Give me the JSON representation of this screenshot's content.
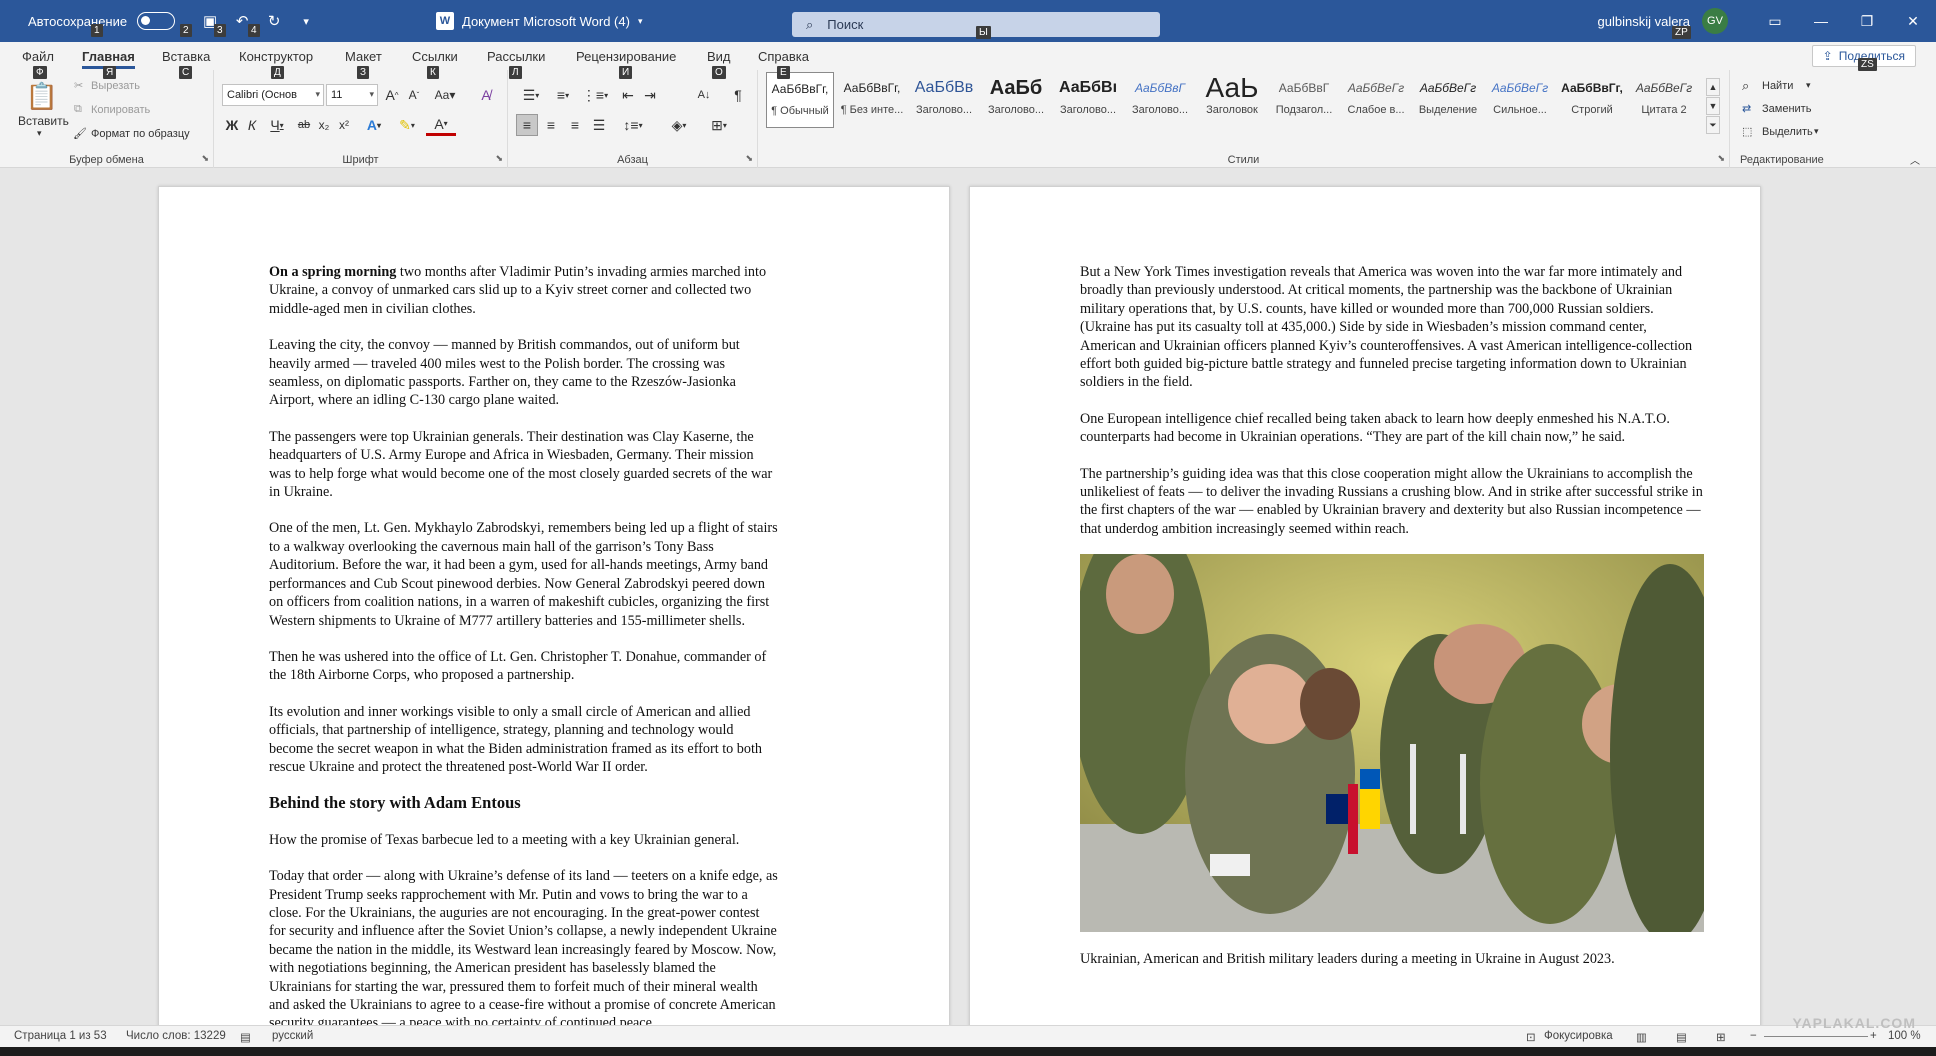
{
  "titlebar": {
    "autosave_label": "Автосохранение",
    "document_title": "Документ Microsoft Word (4)",
    "app_badge": "W",
    "search_placeholder": "Поиск",
    "username": "gulbinskij valera",
    "avatar_initials": "GV",
    "keytips": [
      "1",
      "2",
      "3",
      "4",
      "Ы",
      "ZP"
    ]
  },
  "tabs": [
    {
      "label": "Файл",
      "keytip": "Ф"
    },
    {
      "label": "Главная",
      "keytip": "Я",
      "active": true
    },
    {
      "label": "Вставка",
      "keytip": "С"
    },
    {
      "label": "Конструктор",
      "keytip": "Д"
    },
    {
      "label": "Макет",
      "keytip": "З"
    },
    {
      "label": "Ссылки",
      "keytip": "К"
    },
    {
      "label": "Рассылки",
      "keytip": "Л"
    },
    {
      "label": "Рецензирование",
      "keytip": "И"
    },
    {
      "label": "Вид",
      "keytip": "О"
    },
    {
      "label": "Справка",
      "keytip": "Е"
    }
  ],
  "share": {
    "label": "Поделиться",
    "keytip": "ZS"
  },
  "ribbon": {
    "clipboard": {
      "label": "Буфер обмена",
      "paste": "Вставить",
      "cut": "Вырезать",
      "copy": "Копировать",
      "format_painter": "Формат по образцу"
    },
    "font": {
      "label": "Шрифт",
      "font_name": "Calibri (Основ",
      "font_size": "11"
    },
    "paragraph": {
      "label": "Абзац"
    },
    "styles": {
      "label": "Стили",
      "items": [
        {
          "preview": "АаБбВвГг,",
          "name": "¶ Обычный"
        },
        {
          "preview": "АаБбВвГг,",
          "name": "¶ Без инте..."
        },
        {
          "preview": "АаБбВв",
          "name": "Заголово..."
        },
        {
          "preview": "АаБб",
          "name": "Заголово..."
        },
        {
          "preview": "АаБбВı",
          "name": "Заголово..."
        },
        {
          "preview": "АаБбВвГ",
          "name": "Заголово..."
        },
        {
          "preview": "АаЬ",
          "name": "Заголовок"
        },
        {
          "preview": "АаБбВвГ",
          "name": "Подзагол..."
        },
        {
          "preview": "АаБбВеГг",
          "name": "Слабое в..."
        },
        {
          "preview": "АаБбВеГг",
          "name": "Выделение"
        },
        {
          "preview": "АаБбВеГг",
          "name": "Сильное..."
        },
        {
          "preview": "АаБбВвГг,",
          "name": "Строгий"
        },
        {
          "preview": "АаБбВеГг",
          "name": "Цитата 2"
        }
      ]
    },
    "editing": {
      "label": "Редактирование",
      "find": "Найти",
      "replace": "Заменить",
      "select": "Выделить"
    }
  },
  "page_left": {
    "p1_lead": "On a spring morning",
    "p1_rest": " two months after Vladimir Putin’s invading armies marched into Ukraine, a convoy of unmarked cars slid up to a Kyiv street corner and collected two middle-aged men in civilian clothes.",
    "p2": "Leaving the city, the convoy — manned by British commandos, out of uniform but heavily armed — traveled 400 miles west to the Polish border. The crossing was seamless, on diplomatic passports. Farther on, they came to the Rzeszów-Jasionka Airport, where an idling C-130 cargo plane waited.",
    "p3": "The passengers were top Ukrainian generals. Their destination was Clay Kaserne, the headquarters of U.S. Army Europe and Africa in Wiesbaden, Germany. Their mission was to help forge what would become one of the most closely guarded secrets of the war in Ukraine.",
    "p4": "One of the men, Lt. Gen. Mykhaylo Zabrodskyi, remembers being led up a flight of stairs to a walkway overlooking the cavernous main hall of the garrison’s Tony Bass Auditorium. Before the war, it had been a gym, used for all-hands meetings, Army band performances and Cub Scout pinewood derbies. Now General Zabrodskyi peered down on officers from coalition nations, in a warren of makeshift cubicles, organizing the first Western shipments to Ukraine of M777 artillery batteries and 155-millimeter shells.",
    "p5": "Then he was ushered into the office of Lt. Gen. Christopher T. Donahue, commander of the 18th Airborne Corps, who proposed a partnership.",
    "p6": "Its evolution and inner workings visible to only a small circle of American and allied officials, that partnership of intelligence, strategy, planning and technology would become the secret weapon in what the Biden administration framed as its effort to both rescue Ukraine and protect the threatened post-World War II order.",
    "heading": "Behind the story with Adam Entous",
    "p7": "How the promise of Texas barbecue led to a meeting with a key Ukrainian general.",
    "p8": "Today that order — along with Ukraine’s defense of its land — teeters on a knife edge, as President Trump seeks rapprochement with Mr. Putin and vows to bring the war to a close. For the Ukrainians, the auguries are not encouraging. In the great-power contest for security and influence after the Soviet Union’s collapse, a newly independent Ukraine became the nation in the middle, its Westward lean increasingly feared by Moscow. Now, with negotiations beginning, the American president has baselessly blamed the Ukrainians for starting the war, pressured them to forfeit much of their mineral wealth and asked the Ukrainians to agree to a cease-fire without a promise of concrete American security guarantees — a peace with no certainty of continued peace."
  },
  "page_right": {
    "p1": "But a New York Times investigation reveals that America was woven into the war far more intimately and broadly than previously understood. At critical moments, the partnership was the backbone of Ukrainian military operations that, by U.S. counts, have killed or wounded more than 700,000 Russian soldiers. (Ukraine has put its casualty toll at 435,000.) Side by side in Wiesbaden’s mission command center, American and Ukrainian officers planned Kyiv’s counteroffensives. A vast American intelligence-collection effort both guided big-picture battle strategy and funneled precise targeting information down to Ukrainian soldiers in the field.",
    "p2": "One European intelligence chief recalled being taken aback to learn how deeply enmeshed his N.A.T.O. counterparts had become in Ukrainian operations. “They are part of the kill chain now,” he said.",
    "p3": "The partnership’s guiding idea was that this close cooperation might allow the Ukrainians to accomplish the unlikeliest of feats — to deliver the invading Russians a crushing blow. And in strike after successful strike in the first chapters of the war — enabled by Ukrainian bravery and dexterity but also Russian incompetence — that underdog ambition increasingly seemed within reach.",
    "caption": "Ukrainian, American and British military leaders during a meeting in Ukraine in August 2023."
  },
  "statusbar": {
    "page": "Страница 1 из 53",
    "words": "Число слов: 13229",
    "language": "русский",
    "focus": "Фокусировка",
    "zoom": "100 %"
  },
  "watermark": "YAPLAKAL.COM",
  "colors": {
    "accent": "#2b579a",
    "ribbon_bg": "#f3f3f3",
    "workspace_bg": "#e6e6e6"
  }
}
